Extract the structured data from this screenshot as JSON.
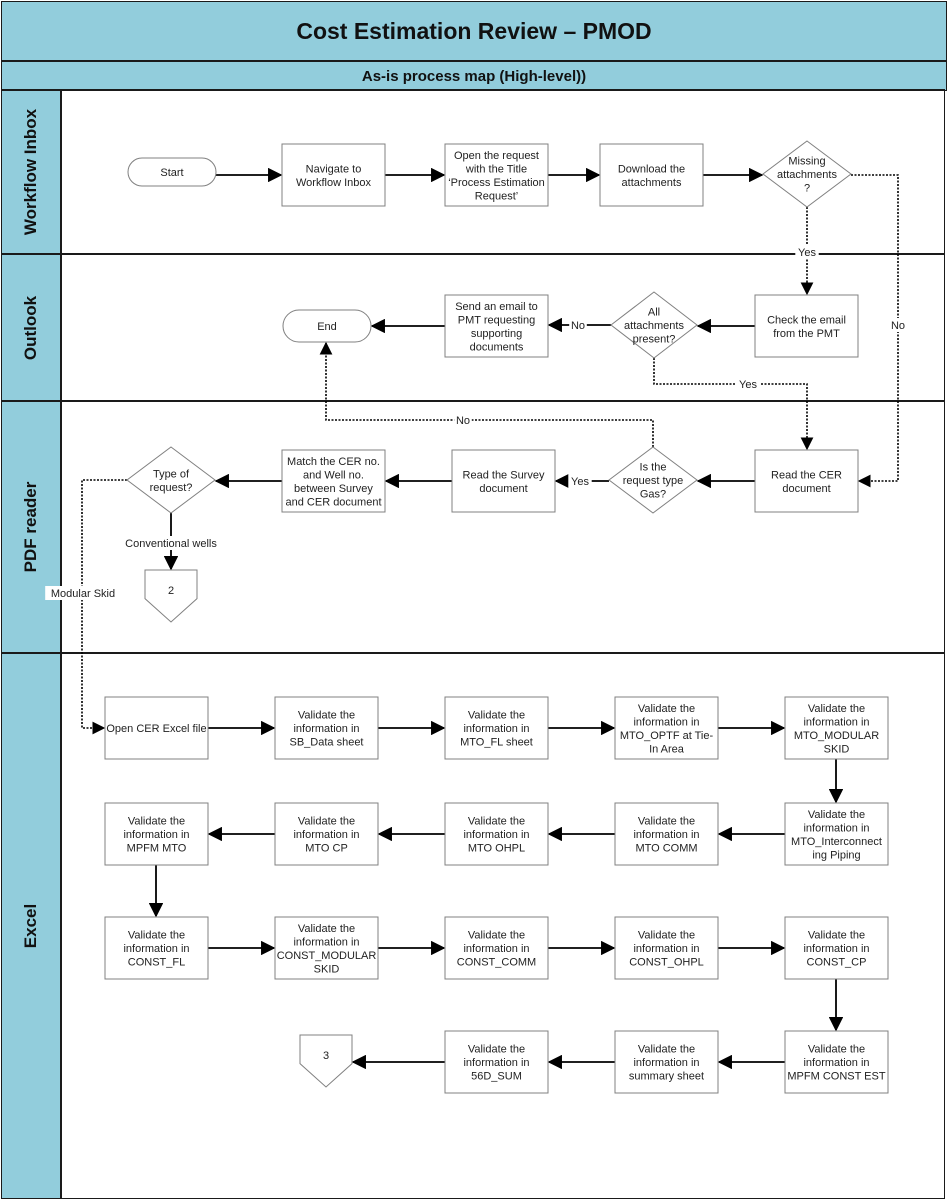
{
  "header": {
    "title": "Cost Estimation Review – PMOD",
    "subtitle": "As-is process map (High-level))"
  },
  "colors": {
    "header_bg": "#92cddc",
    "lane_bg": "#92cddc",
    "box_stroke": "#808080",
    "line": "#000000"
  },
  "lanes": [
    {
      "id": "workflow",
      "label": "Workflow Inbox"
    },
    {
      "id": "outlook",
      "label": "Outlook"
    },
    {
      "id": "pdf",
      "label": "PDF reader"
    },
    {
      "id": "excel",
      "label": "Excel"
    }
  ],
  "nodes": {
    "start": {
      "type": "terminator",
      "lines": [
        "Start"
      ]
    },
    "navigate": {
      "type": "process",
      "lines": [
        "Navigate to",
        "Workflow Inbox"
      ]
    },
    "open_request": {
      "type": "process",
      "lines": [
        "Open the request",
        "with the Title",
        "‘Process Estimation",
        "Request’"
      ]
    },
    "download": {
      "type": "process",
      "lines": [
        "Download the",
        "attachments"
      ]
    },
    "missing": {
      "type": "decision",
      "lines": [
        "Missing",
        "attachments",
        "?"
      ]
    },
    "check_email": {
      "type": "process",
      "lines": [
        "Check the email",
        "from the PMT"
      ]
    },
    "all_present": {
      "type": "decision",
      "lines": [
        "All",
        "attachments",
        "present?"
      ]
    },
    "send_email": {
      "type": "process",
      "lines": [
        "Send an email to",
        "PMT requesting",
        "supporting",
        "documents"
      ]
    },
    "end": {
      "type": "terminator",
      "lines": [
        "End"
      ]
    },
    "read_cer": {
      "type": "process",
      "lines": [
        "Read the CER",
        "document"
      ]
    },
    "is_gas": {
      "type": "decision",
      "lines": [
        "Is the",
        "request type",
        "Gas?"
      ]
    },
    "read_survey": {
      "type": "process",
      "lines": [
        "Read the Survey",
        "document"
      ]
    },
    "match": {
      "type": "process",
      "lines": [
        "Match the CER no.",
        "and Well no.",
        "between Survey",
        "and CER document"
      ]
    },
    "type_req": {
      "type": "decision",
      "lines": [
        "Type of",
        "request?"
      ]
    },
    "conn2": {
      "type": "offpage",
      "lines": [
        "2"
      ]
    },
    "open_excel": {
      "type": "process",
      "lines": [
        "Open CER Excel file"
      ]
    },
    "v_sb": {
      "type": "process",
      "lines": [
        "Validate the",
        "information in",
        "SB_Data sheet"
      ]
    },
    "v_mto_fl": {
      "type": "process",
      "lines": [
        "Validate the",
        "information in",
        "MTO_FL sheet"
      ]
    },
    "v_optf": {
      "type": "process",
      "lines": [
        "Validate the",
        "information in",
        "MTO_OPTF at Tie-",
        "In Area"
      ]
    },
    "v_mod_skid": {
      "type": "process",
      "lines": [
        "Validate the",
        "information in",
        "MTO_MODULAR",
        "SKID"
      ]
    },
    "v_interconn": {
      "type": "process",
      "lines": [
        "Validate the",
        "information in",
        "MTO_Interconnect",
        "ing Piping"
      ]
    },
    "v_mto_comm": {
      "type": "process",
      "lines": [
        "Validate the",
        "information in",
        "MTO COMM"
      ]
    },
    "v_mto_ohpl": {
      "type": "process",
      "lines": [
        "Validate the",
        "information in",
        "MTO OHPL"
      ]
    },
    "v_mto_cp": {
      "type": "process",
      "lines": [
        "Validate the",
        "information in",
        "MTO CP"
      ]
    },
    "v_mpfm_mto": {
      "type": "process",
      "lines": [
        "Validate the",
        "information in",
        "MPFM MTO"
      ]
    },
    "v_const_fl": {
      "type": "process",
      "lines": [
        "Validate the",
        "information in",
        "CONST_FL"
      ]
    },
    "v_const_mod": {
      "type": "process",
      "lines": [
        "Validate the",
        "information in",
        "CONST_MODULAR",
        "SKID"
      ]
    },
    "v_const_comm": {
      "type": "process",
      "lines": [
        "Validate the",
        "information in",
        "CONST_COMM"
      ]
    },
    "v_const_ohpl": {
      "type": "process",
      "lines": [
        "Validate the",
        "information in",
        "CONST_OHPL"
      ]
    },
    "v_const_cp": {
      "type": "process",
      "lines": [
        "Validate the",
        "information in",
        "CONST_CP"
      ]
    },
    "v_mpfm_const": {
      "type": "process",
      "lines": [
        "Validate the",
        "information in",
        "MPFM CONST EST"
      ]
    },
    "v_summary": {
      "type": "process",
      "lines": [
        "Validate the",
        "information in",
        "summary sheet"
      ]
    },
    "v_56d": {
      "type": "process",
      "lines": [
        "Validate the",
        "information in",
        "56D_SUM"
      ]
    },
    "conn3": {
      "type": "offpage",
      "lines": [
        "3"
      ]
    }
  },
  "edges": [
    {
      "from": "start",
      "to": "navigate",
      "label": "",
      "style": "solid"
    },
    {
      "from": "navigate",
      "to": "open_request",
      "label": "",
      "style": "solid"
    },
    {
      "from": "open_request",
      "to": "download",
      "label": "",
      "style": "solid"
    },
    {
      "from": "download",
      "to": "missing",
      "label": "",
      "style": "solid"
    },
    {
      "from": "missing",
      "to": "check_email",
      "label": "Yes",
      "style": "dotted"
    },
    {
      "from": "missing",
      "to": "read_cer",
      "label": "No",
      "style": "dotted"
    },
    {
      "from": "check_email",
      "to": "all_present",
      "label": "",
      "style": "solid"
    },
    {
      "from": "all_present",
      "to": "send_email",
      "label": "No",
      "style": "solid"
    },
    {
      "from": "all_present",
      "to": "read_cer",
      "label": "Yes",
      "style": "dotted"
    },
    {
      "from": "send_email",
      "to": "end",
      "label": "",
      "style": "solid"
    },
    {
      "from": "read_cer",
      "to": "is_gas",
      "label": "",
      "style": "solid"
    },
    {
      "from": "is_gas",
      "to": "read_survey",
      "label": "Yes",
      "style": "solid"
    },
    {
      "from": "is_gas",
      "to": "end",
      "label": "No",
      "style": "dotted"
    },
    {
      "from": "read_survey",
      "to": "match",
      "label": "",
      "style": "solid"
    },
    {
      "from": "match",
      "to": "type_req",
      "label": "",
      "style": "solid"
    },
    {
      "from": "type_req",
      "to": "conn2",
      "label": "Conventional wells",
      "style": "solid"
    },
    {
      "from": "type_req",
      "to": "open_excel",
      "label": "Modular Skid",
      "style": "dotted"
    },
    {
      "from": "open_excel",
      "to": "v_sb",
      "label": "",
      "style": "solid"
    },
    {
      "from": "v_sb",
      "to": "v_mto_fl",
      "label": "",
      "style": "solid"
    },
    {
      "from": "v_mto_fl",
      "to": "v_optf",
      "label": "",
      "style": "solid"
    },
    {
      "from": "v_optf",
      "to": "v_mod_skid",
      "label": "",
      "style": "solid"
    },
    {
      "from": "v_mod_skid",
      "to": "v_interconn",
      "label": "",
      "style": "solid"
    },
    {
      "from": "v_interconn",
      "to": "v_mto_comm",
      "label": "",
      "style": "solid"
    },
    {
      "from": "v_mto_comm",
      "to": "v_mto_ohpl",
      "label": "",
      "style": "solid"
    },
    {
      "from": "v_mto_ohpl",
      "to": "v_mto_cp",
      "label": "",
      "style": "solid"
    },
    {
      "from": "v_mto_cp",
      "to": "v_mpfm_mto",
      "label": "",
      "style": "solid"
    },
    {
      "from": "v_mpfm_mto",
      "to": "v_const_fl",
      "label": "",
      "style": "solid"
    },
    {
      "from": "v_const_fl",
      "to": "v_const_mod",
      "label": "",
      "style": "solid"
    },
    {
      "from": "v_const_mod",
      "to": "v_const_comm",
      "label": "",
      "style": "solid"
    },
    {
      "from": "v_const_comm",
      "to": "v_const_ohpl",
      "label": "",
      "style": "solid"
    },
    {
      "from": "v_const_ohpl",
      "to": "v_const_cp",
      "label": "",
      "style": "solid"
    },
    {
      "from": "v_const_cp",
      "to": "v_mpfm_const",
      "label": "",
      "style": "solid"
    },
    {
      "from": "v_mpfm_const",
      "to": "v_summary",
      "label": "",
      "style": "solid"
    },
    {
      "from": "v_summary",
      "to": "v_56d",
      "label": "",
      "style": "solid"
    },
    {
      "from": "v_56d",
      "to": "conn3",
      "label": "",
      "style": "solid"
    }
  ]
}
